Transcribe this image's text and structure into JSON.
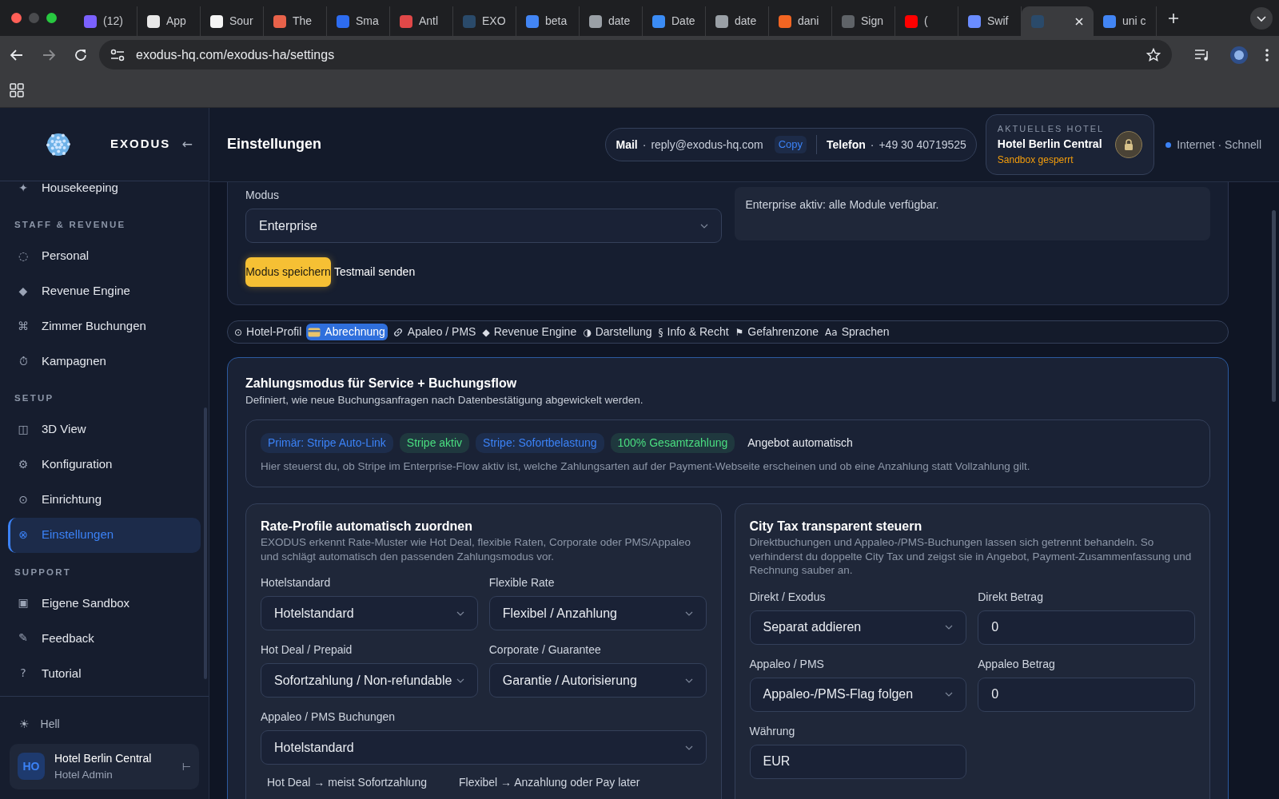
{
  "browser": {
    "tabs": [
      {
        "title": "(12)",
        "color": "#7b61ff",
        "selected": false
      },
      {
        "title": "App",
        "color": "#e8e8e8",
        "selected": false
      },
      {
        "title": "Sour",
        "color": "#f5f5f5",
        "selected": false
      },
      {
        "title": "The",
        "color": "#e8624a",
        "selected": false
      },
      {
        "title": "Sma",
        "color": "#2d6cf0",
        "selected": false
      },
      {
        "title": "Antl",
        "color": "#e04848",
        "selected": false
      },
      {
        "title": "EXO",
        "color": "#2a4a6a",
        "selected": false
      },
      {
        "title": "beta",
        "color": "#4285f4",
        "selected": false
      },
      {
        "title": "date",
        "color": "#9aa0a6",
        "selected": false
      },
      {
        "title": "Date",
        "color": "#3b8cf5",
        "selected": false
      },
      {
        "title": "date",
        "color": "#9aa0a6",
        "selected": false
      },
      {
        "title": "dani",
        "color": "#f26522",
        "selected": false
      },
      {
        "title": "Sign",
        "color": "#5f6368",
        "selected": false
      },
      {
        "title": "(",
        "color": "#ff0000",
        "selected": false
      },
      {
        "title": "Swif",
        "color": "#6a8cff",
        "selected": false
      },
      {
        "color": "#2a4a6a",
        "selected": true
      },
      {
        "title": "uni c",
        "color": "#4285f4",
        "selected": false
      }
    ],
    "address": "exodus-hq.com/exodus-ha/settings"
  },
  "sidebar": {
    "brand": "EXODUS",
    "collapse": "←",
    "sections": [
      {
        "items": [
          {
            "icon": "✦",
            "label": "Housekeeping",
            "selected": false
          }
        ]
      },
      {
        "heading": "STAFF & REVENUE",
        "items": [
          {
            "icon": "◌",
            "label": "Personal",
            "selected": false
          },
          {
            "icon": "◆",
            "label": "Revenue Engine",
            "selected": false
          },
          {
            "icon": "⌘",
            "label": "Zimmer Buchungen",
            "selected": false
          },
          {
            "icon": "⏱",
            "label": "Kampagnen",
            "selected": false
          }
        ]
      },
      {
        "heading": "SETUP",
        "items": [
          {
            "icon": "◫",
            "label": "3D View",
            "selected": false
          },
          {
            "icon": "⚙",
            "label": "Konfiguration",
            "selected": false
          },
          {
            "icon": "⊙",
            "label": "Einrichtung",
            "selected": false
          },
          {
            "icon": "⊗",
            "label": "Einstellungen",
            "selected": true
          }
        ]
      },
      {
        "heading": "SUPPORT",
        "items": [
          {
            "icon": "▣",
            "label": "Eigene Sandbox",
            "selected": false
          },
          {
            "icon": "✎",
            "label": "Feedback",
            "selected": false
          },
          {
            "icon": "?",
            "label": "Tutorial",
            "selected": false
          }
        ]
      }
    ],
    "theme_toggle": {
      "icon": "☀",
      "label": "Hell"
    },
    "user": {
      "initials": "HO",
      "name": "Hotel Berlin Central",
      "role": "Hotel Admin",
      "action": "⊢"
    }
  },
  "header": {
    "title": "Einstellungen",
    "contacts": [
      {
        "label": "Mail",
        "separator": "·",
        "value": "reply@exodus-hq.com",
        "action": "Copy"
      },
      {
        "label": "Telefon",
        "separator": "·",
        "value": "+49 30 40719525"
      }
    ],
    "hotel": {
      "caption": "AKTUELLES HOTEL",
      "name": "Hotel Berlin Central",
      "status": "Sandbox gesperrt"
    },
    "connection": {
      "text": "Internet · Schnell",
      "color": "#3b82f6"
    }
  },
  "mode_card": {
    "label": "Modus",
    "value": "Enterprise",
    "info": "Enterprise aktiv: alle Module verfügbar.",
    "buttons": [
      {
        "label": "Modus speichern",
        "kind": "primary"
      },
      {
        "label": "Testmail senden",
        "kind": "plain"
      }
    ]
  },
  "section_tabs": [
    {
      "kind": "glyph",
      "icon": "⊙",
      "label": "Hotel-Profil",
      "selected": false
    },
    {
      "kind": "card",
      "label": "Abrechnung",
      "selected": true
    },
    {
      "kind": "link",
      "label": "Apaleo / PMS",
      "selected": false
    },
    {
      "kind": "glyph",
      "icon": "◆",
      "label": "Revenue Engine",
      "selected": false
    },
    {
      "kind": "glyph",
      "icon": "◑",
      "label": "Darstellung",
      "selected": false
    },
    {
      "kind": "glyph",
      "icon": "§",
      "label": "Info & Recht",
      "selected": false
    },
    {
      "kind": "glyph",
      "icon": "⚑",
      "label": "Gefahrenzone",
      "selected": false
    },
    {
      "kind": "glyph",
      "icon": "Aa",
      "label": "Sprachen",
      "selected": false
    }
  ],
  "payment_card": {
    "title": "Zahlungsmodus für Service + Buchungsflow",
    "subtitle": "Definiert, wie neue Buchungsanfragen nach Datenbestätigung abgewickelt werden.",
    "badges": [
      {
        "text": "Primär: Stripe Auto-Link",
        "color": "#3b82f6"
      },
      {
        "text": "Stripe aktiv",
        "color": "#4ade80"
      },
      {
        "text": "Stripe: Sofortbelastung",
        "color": "#3b82f6"
      },
      {
        "text": "100% Gesamtzahlung",
        "color": "#4ade80"
      }
    ],
    "note": "Angebot automatisch",
    "description": "Hier steuerst du, ob Stripe im Enterprise-Flow aktiv ist, welche Zahlungsarten auf der Payment-Webseite erscheinen und ob eine Anzahlung statt Vollzahlung gilt.",
    "panels": [
      {
        "title": "Rate-Profile automatisch zuordnen",
        "description": "EXODUS erkennt Rate-Muster wie Hot Deal, flexible Raten, Corporate oder PMS/Appaleo und schlägt automatisch den passenden Zahlungsmodus vor.",
        "fields": [
          {
            "label": "Hotelstandard",
            "kind": "select",
            "value": "Hotelstandard",
            "wide": false
          },
          {
            "label": "Flexible Rate",
            "kind": "select",
            "value": "Flexibel / Anzahlung",
            "wide": false
          },
          {
            "label": "Hot Deal / Prepaid",
            "kind": "select",
            "value": "Sofortzahlung / Non-refundable",
            "wide": false
          },
          {
            "label": "Corporate / Guarantee",
            "kind": "select",
            "value": "Garantie / Autorisierung",
            "wide": false
          },
          {
            "label": "Appaleo / PMS Buchungen",
            "kind": "select",
            "value": "Hotelstandard",
            "wide": true
          }
        ],
        "hints": [
          "Hot Deal → meist Sofortzahlung",
          "Flexibel → Anzahlung oder Pay later"
        ]
      },
      {
        "title": "City Tax transparent steuern",
        "description": "Direktbuchungen und Appaleo-/PMS-Buchungen lassen sich getrennt behandeln. So verhinderst du doppelte City Tax und zeigst sie in Angebot, Payment-Zusammenfassung und Rechnung sauber an.",
        "fields": [
          {
            "label": "Direkt / Exodus",
            "kind": "select",
            "value": "Separat addieren",
            "wide": false
          },
          {
            "label": "Direkt Betrag",
            "kind": "input",
            "value": "0",
            "wide": false
          },
          {
            "label": "Appaleo / PMS",
            "kind": "select",
            "value": "Appaleo-/PMS-Flag folgen",
            "wide": false
          },
          {
            "label": "Appaleo Betrag",
            "kind": "input",
            "value": "0",
            "wide": false
          },
          {
            "label": "Währung",
            "kind": "input",
            "value": "EUR",
            "wide": false
          }
        ]
      }
    ]
  }
}
